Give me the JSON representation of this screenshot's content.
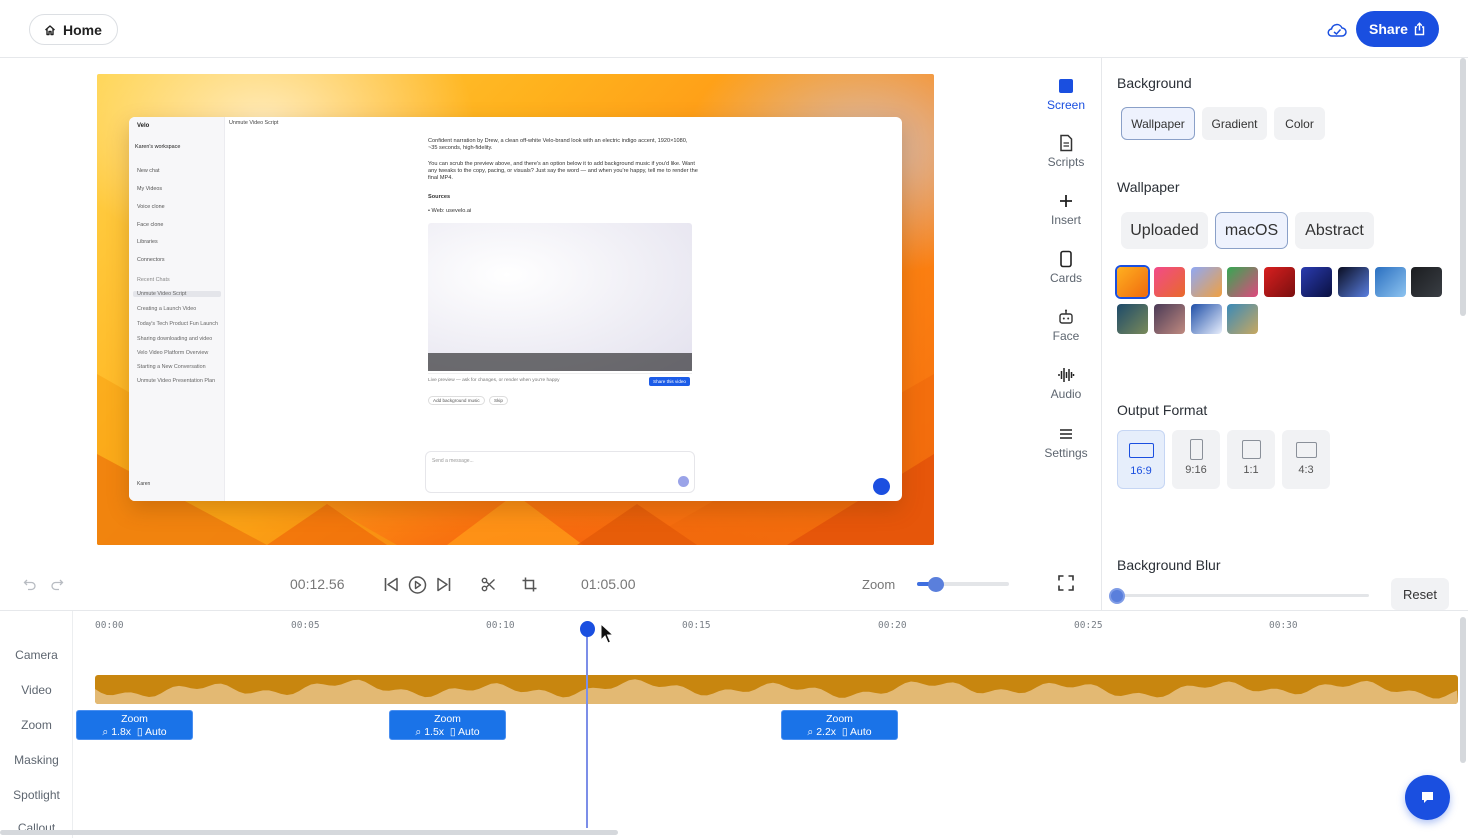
{
  "header": {
    "home_label": "Home",
    "share_label": "Share"
  },
  "preview": {
    "app": {
      "brand": "Velo",
      "workspace": "Karen's workspace",
      "breadcrumb": "Unmute Video Script",
      "sidebar_items": [
        "New chat",
        "My Videos",
        "Voice clone",
        "Face clone",
        "Libraries",
        "Connectors"
      ],
      "recent_title": "Recent Chats",
      "recent_chats": [
        "Unmute Video Script",
        "Creating a Launch Video",
        "Today's Tech Product Fun Launch",
        "Sharing downloading and video",
        "Velo Video Platform Overview",
        "Starting a New Conversation",
        "Unmute Video Presentation Plan"
      ],
      "user": "Karen",
      "para1": "Confident narration by Drew, a clean off-white Velo-brand look with an electric indigo accent, 1920×1080, ~35 seconds, high-fidelity.",
      "para2": "You can scrub the preview above, and there's an option below it to add background music if you'd like. Want any tweaks to the copy, pacing, or visuals? Just say the word — and when you're happy, tell me to render the final MP4.",
      "sources_title": "Sources",
      "source_item": "• Web: usevelo.ai",
      "live_text": "Live preview — ask for changes, or render when you're happy",
      "share_video": "Share this video",
      "chip_music": "Add background music",
      "chip_skip": "Skip",
      "message_placeholder": "Send a message..."
    }
  },
  "tools": [
    {
      "label": "Screen",
      "icon": "screen-icon",
      "active": true
    },
    {
      "label": "Scripts",
      "icon": "document-icon",
      "active": false
    },
    {
      "label": "Insert",
      "icon": "plus-icon",
      "active": false
    },
    {
      "label": "Cards",
      "icon": "card-icon",
      "active": false
    },
    {
      "label": "Face",
      "icon": "robot-icon",
      "active": false
    },
    {
      "label": "Audio",
      "icon": "waveform-icon",
      "active": false
    },
    {
      "label": "Settings",
      "icon": "menu-icon",
      "active": false
    }
  ],
  "panel": {
    "background_title": "Background",
    "background_tabs": [
      "Wallpaper",
      "Gradient",
      "Color"
    ],
    "background_selected": "Wallpaper",
    "wallpaper_title": "Wallpaper",
    "wallpaper_tabs": [
      "Uploaded",
      "macOS",
      "Abstract"
    ],
    "wallpaper_selected": "macOS",
    "wallpapers": [
      {
        "colors": [
          "#ffb020",
          "#f06a0e"
        ],
        "selected": true
      },
      {
        "colors": [
          "#f24a8a",
          "#e86a2a"
        ],
        "selected": false
      },
      {
        "colors": [
          "#8fa8f5",
          "#f0a040"
        ],
        "selected": false
      },
      {
        "colors": [
          "#35a852",
          "#e0487e"
        ],
        "selected": false
      },
      {
        "colors": [
          "#d81f1f",
          "#7a0f0f"
        ],
        "selected": false
      },
      {
        "colors": [
          "#2a3bb0",
          "#0a1040"
        ],
        "selected": false
      },
      {
        "colors": [
          "#0a0e22",
          "#5a7fe0"
        ],
        "selected": false
      },
      {
        "colors": [
          "#2a6fc0",
          "#8ec4f0"
        ],
        "selected": false
      },
      {
        "colors": [
          "#1b1d20",
          "#3a3e44"
        ],
        "selected": false
      },
      {
        "colors": [
          "#1d4a6a",
          "#7a8a5a"
        ],
        "selected": false
      },
      {
        "colors": [
          "#4a3a56",
          "#c08a80"
        ],
        "selected": false
      },
      {
        "colors": [
          "#1f4fa8",
          "#e8eefc"
        ],
        "selected": false
      },
      {
        "colors": [
          "#3a8ab8",
          "#c8a860"
        ],
        "selected": false
      }
    ],
    "output_title": "Output Format",
    "formats": [
      {
        "label": "16:9",
        "selected": true
      },
      {
        "label": "9:16",
        "selected": false
      },
      {
        "label": "1:1",
        "selected": false
      },
      {
        "label": "4:3",
        "selected": false
      }
    ],
    "blur_title": "Background Blur",
    "blur_value": 0,
    "reset_label": "Reset"
  },
  "playback": {
    "current_time": "00:12.56",
    "total_time": "01:05.00",
    "zoom_label": "Zoom",
    "zoom_level": 0.22
  },
  "timeline": {
    "track_labels": [
      "Camera",
      "Video",
      "Zoom",
      "Masking",
      "Spotlight",
      "Callout"
    ],
    "ticks": [
      "00:00",
      "00:05",
      "00:10",
      "00:15",
      "00:20",
      "00:25",
      "00:30"
    ],
    "zoom_clips": [
      {
        "title": "Zoom",
        "factor": "1.8x",
        "mode": "Auto"
      },
      {
        "title": "Zoom",
        "factor": "1.5x",
        "mode": "Auto"
      },
      {
        "title": "Zoom",
        "factor": "2.2x",
        "mode": "Auto"
      }
    ]
  },
  "colors": {
    "accent": "#1a4fe0",
    "video_clip": "#c8860f",
    "zoom_clip": "#1a73e8"
  }
}
